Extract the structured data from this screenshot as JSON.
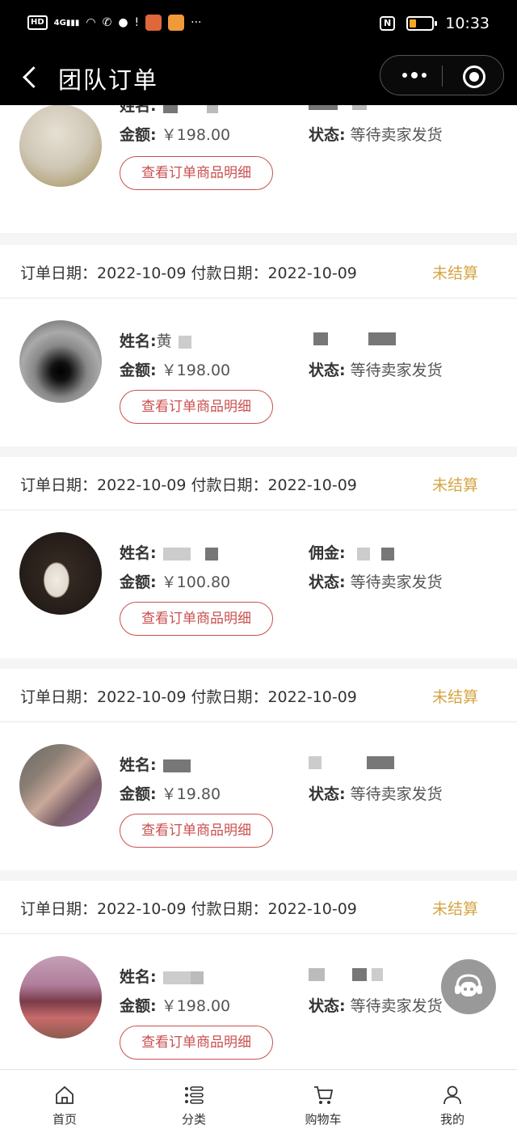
{
  "status_bar": {
    "left_icons": [
      "HD",
      "4G",
      "signal",
      "wifi",
      "missed-call",
      "app",
      "warning",
      "app",
      "app",
      "more"
    ],
    "time": "10:33",
    "nfc": "N"
  },
  "nav": {
    "title": "团队订单"
  },
  "labels": {
    "name": "姓名:",
    "amount": "金额:",
    "status": "状态:",
    "commission": "佣金:",
    "detail_button": "查看订单商品明细"
  },
  "orders": [
    {
      "name": "",
      "amount": "￥198.00",
      "status": "等待卖家发货"
    },
    {
      "order_date": "订单日期：2022-10-09",
      "pay_date": "付款日期：2022-10-09",
      "settle": "未结算",
      "name": "黄",
      "amount": "￥198.00",
      "status": "等待卖家发货"
    },
    {
      "order_date": "订单日期：2022-10-09",
      "pay_date": "付款日期：2022-10-09",
      "settle": "未结算",
      "name": "",
      "amount": "￥100.80",
      "status": "等待卖家发货"
    },
    {
      "order_date": "订单日期：2022-10-09",
      "pay_date": "付款日期：2022-10-09",
      "settle": "未结算",
      "name": "",
      "amount": "￥19.80",
      "status": "等待卖家发货"
    },
    {
      "order_date": "订单日期：2022-10-09",
      "pay_date": "付款日期：2022-10-09",
      "settle": "未结算",
      "name": "",
      "amount": "￥198.00",
      "status": "等待卖家发货"
    }
  ],
  "tabbar": {
    "items": [
      {
        "label": "首页",
        "icon": "home-icon"
      },
      {
        "label": "分类",
        "icon": "category-icon"
      },
      {
        "label": "购物车",
        "icon": "cart-icon"
      },
      {
        "label": "我的",
        "icon": "user-icon"
      }
    ]
  }
}
